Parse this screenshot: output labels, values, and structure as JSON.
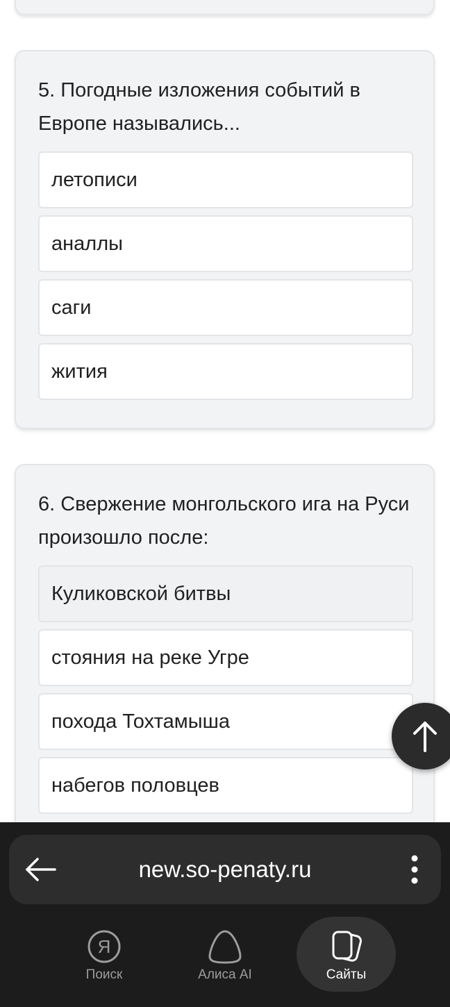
{
  "questions": [
    {
      "text": "5. Погодные изложения событий в Европе назывались...",
      "options": [
        "летописи",
        "аналлы",
        "саги",
        "жития"
      ]
    },
    {
      "text": "6. Свержение монгольского ига на Руси произошло после:",
      "options": [
        "Куликовской битвы",
        "стояния на реке Угре",
        "похода Тохтамыша",
        "набегов половцев"
      ]
    }
  ],
  "browser": {
    "url": "new.so-penaty.ru",
    "nav": {
      "search_label": "Поиск",
      "alice_label": "Алиса AI",
      "sites_label": "Сайты"
    },
    "search_icon_glyph": "Я"
  },
  "icons": {
    "scroll_top": "arrow-up-icon",
    "back": "arrow-left-icon",
    "menu": "more-vertical-icon",
    "search": "yandex-search-icon",
    "alice": "alice-icon",
    "sites": "tabs-icon"
  },
  "colors": {
    "card_bg": "#f2f3f5",
    "option_bg": "#ffffff",
    "selected_option_bg": "#f0f1f3",
    "bottom_bar_bg": "#1c1c1c",
    "url_bar_bg": "#2d2d2d",
    "active_nav_bg": "#333333"
  }
}
